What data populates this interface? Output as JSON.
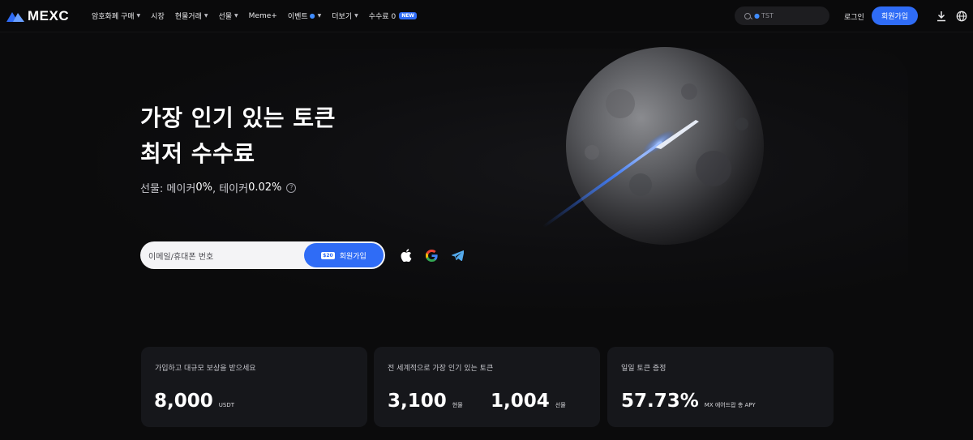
{
  "brand": {
    "name": "MEXC"
  },
  "nav": {
    "items": [
      {
        "label": "암호화폐 구매",
        "caret": true
      },
      {
        "label": "시장",
        "caret": false
      },
      {
        "label": "현물거래",
        "caret": true
      },
      {
        "label": "선물",
        "caret": true
      },
      {
        "label": "Meme+",
        "caret": false
      },
      {
        "label": "이벤트",
        "caret": true,
        "icon": "drop-icon"
      },
      {
        "label": "더보기",
        "caret": true
      },
      {
        "label": "수수료 0",
        "caret": false,
        "badge": "NEW"
      }
    ],
    "search_value": "TST",
    "login": "로그인",
    "signup": "회원가입"
  },
  "hero": {
    "title_line1": "가장 인기 있는 토큰",
    "title_line2": "최저 수수료",
    "fee_prefix": "선물: 메이커 ",
    "maker_fee": "0%",
    "fee_mid": ", 테이커 ",
    "taker_fee": "0.02%",
    "email_placeholder": "이메일/휴대폰 번호",
    "gift_badge": "$20",
    "signup": "회원가입",
    "social": [
      "apple-icon",
      "google-icon",
      "telegram-icon"
    ]
  },
  "cards": [
    {
      "label": "가입하고 대규모 보상을 받으세요",
      "stats": [
        {
          "value": "8,000",
          "unit": "USDT"
        }
      ]
    },
    {
      "label": "전 세계적으로 가장 인기 있는 토큰",
      "stats": [
        {
          "value": "3,100",
          "unit": "현물"
        },
        {
          "value": "1,004",
          "unit": "선물"
        }
      ]
    },
    {
      "label": "일일 토큰 증정",
      "stats": [
        {
          "value": "57.73%",
          "unit": "MX 에어드랍 총 APY"
        }
      ]
    }
  ],
  "colors": {
    "accent": "#2f6cf6",
    "background": "#0b0b0c",
    "card": "#16171b"
  }
}
